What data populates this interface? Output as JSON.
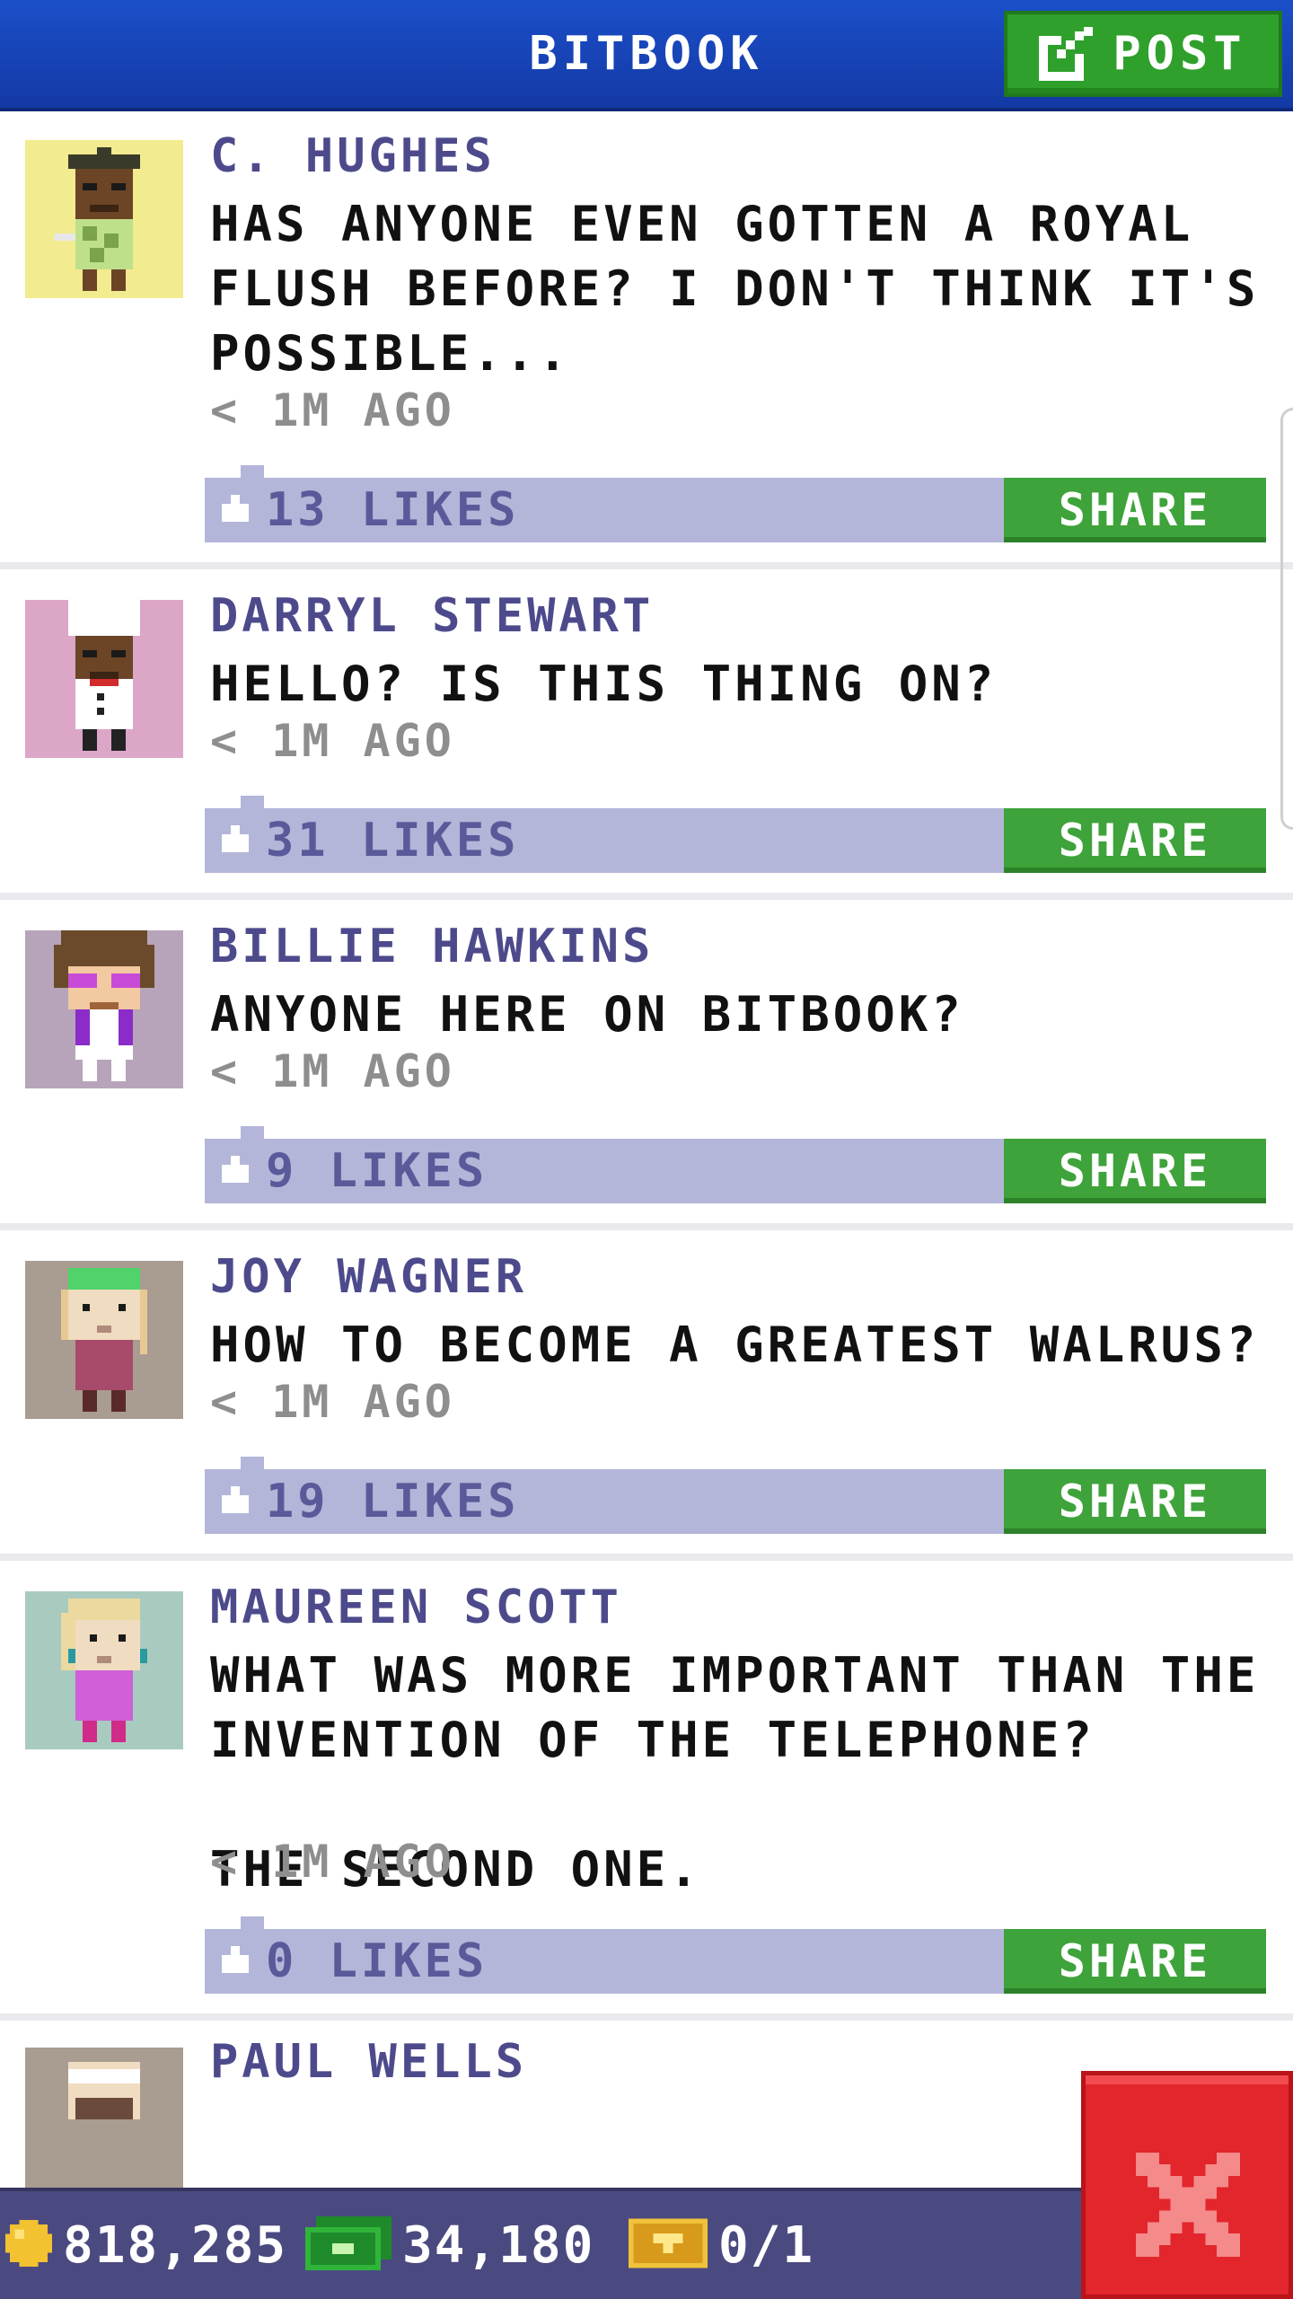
{
  "header": {
    "title": "BITBOOK",
    "post_label": "POST",
    "post_icon": "edit-icon"
  },
  "posts": [
    {
      "author": "C. HUGHES",
      "message": "HAS ANYONE EVEN GOTTEN A ROYAL\nFLUSH BEFORE? I DON'T THINK IT'S\nPOSSIBLE...",
      "time": "< 1M AGO",
      "likes": "13 LIKES",
      "share": "SHARE",
      "avatar_bg": "#f2eb8f"
    },
    {
      "author": "DARRYL STEWART",
      "message": "HELLO? IS THIS THING ON?",
      "time": "< 1M AGO",
      "likes": "31 LIKES",
      "share": "SHARE",
      "avatar_bg": "#dca6c7"
    },
    {
      "author": "BILLIE HAWKINS",
      "message": "ANYONE HERE ON BITBOOK?",
      "time": "< 1M AGO",
      "likes": "9 LIKES",
      "share": "SHARE",
      "avatar_bg": "#b7a4ba"
    },
    {
      "author": "JOY WAGNER",
      "message": "HOW TO BECOME A GREATEST WALRUS?",
      "time": "< 1M AGO",
      "likes": "19 LIKES",
      "share": "SHARE",
      "avatar_bg": "#a99c91"
    },
    {
      "author": "MAUREEN SCOTT",
      "message": "WHAT WAS MORE IMPORTANT THAN THE\nINVENTION OF THE TELEPHONE?\n\nTHE SECOND ONE.",
      "time": "< 1M AGO",
      "likes": "0 LIKES",
      "share": "SHARE",
      "avatar_bg": "#a9cbbf"
    },
    {
      "author": "PAUL WELLS",
      "avatar_bg": "#a99c91"
    }
  ],
  "bottom_bar": {
    "coins": "818,285",
    "cash": "34,180",
    "tickets": "0/1"
  },
  "close_icon": "close-icon"
}
